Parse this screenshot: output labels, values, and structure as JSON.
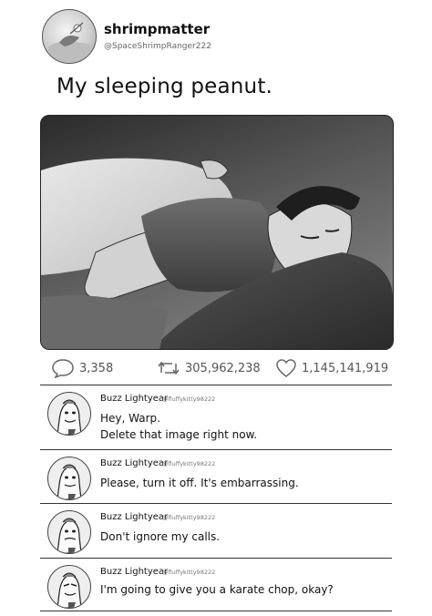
{
  "post": {
    "username": "shrimpmatter",
    "handle": "@SpaceShrimpRanger222",
    "text": "My sleeping peanut."
  },
  "stats": {
    "replies": "3,358",
    "retweets": "305,962,238",
    "likes": "1,145,141,919"
  },
  "replies": [
    {
      "name": "Buzz Lightyear",
      "handle": "@fluffykitty98222",
      "lines": [
        "Hey, Warp.",
        "Delete that image right now."
      ]
    },
    {
      "name": "Buzz Lightyear",
      "handle": "@fluffykitty98222",
      "lines": [
        "Please, turn it off. It's embarrassing."
      ]
    },
    {
      "name": "Buzz Lightyear",
      "handle": "@fluffykitty98222",
      "lines": [
        "Don't ignore my calls."
      ]
    },
    {
      "name": "Buzz Lightyear",
      "handle": "@fluffykitty98222",
      "lines": [
        "I'm going to give you a karate chop, okay?"
      ]
    }
  ],
  "icons": {
    "reply": "speech-bubble-icon",
    "retweet": "retweet-icon",
    "like": "heart-icon"
  }
}
